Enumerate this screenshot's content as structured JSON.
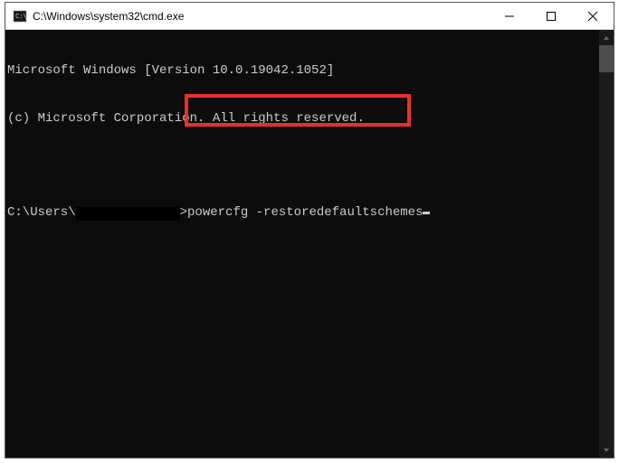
{
  "titlebar": {
    "title": "C:\\Windows\\system32\\cmd.exe"
  },
  "console": {
    "line1": "Microsoft Windows [Version 10.0.19042.1052]",
    "line2": "(c) Microsoft Corporation. All rights reserved.",
    "prompt_prefix": "C:\\Users\\",
    "prompt_suffix": ">",
    "command": "powercfg -restoredefaultschemes"
  }
}
